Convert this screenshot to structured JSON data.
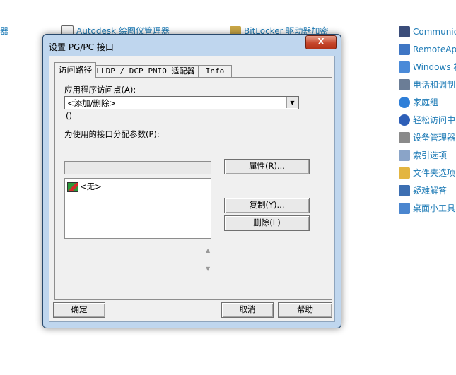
{
  "background": {
    "left_fragment": "器",
    "top_links": [
      {
        "label": "Autodesk 绘图仪管理器",
        "icon": "plotter-icon"
      },
      {
        "label": "BitLocker 驱动器加密",
        "icon": "bitlocker-icon"
      }
    ],
    "right_items": [
      {
        "label": "Communic",
        "icon": "comm-settings-icon",
        "color": "#3b4d7a"
      },
      {
        "label": "RemoteAp",
        "icon": "remoteapp-icon",
        "color": "#3f76c4"
      },
      {
        "label": "Windows 衫",
        "icon": "windows-icon",
        "color": "#4a8ad8"
      },
      {
        "label": "电话和调制",
        "icon": "phone-modem-icon",
        "color": "#6b7d96"
      },
      {
        "label": "家庭组",
        "icon": "homegroup-icon",
        "color": "#2f7fd8"
      },
      {
        "label": "轻松访问中",
        "icon": "ease-of-access-icon",
        "color": "#2e5fb8"
      },
      {
        "label": "设备管理器",
        "icon": "device-manager-icon",
        "color": "#8a8a8a"
      },
      {
        "label": "索引选项",
        "icon": "indexing-icon",
        "color": "#8aa4c8"
      },
      {
        "label": "文件夹选项",
        "icon": "folder-options-icon",
        "color": "#e3b541"
      },
      {
        "label": "疑难解答",
        "icon": "troubleshoot-icon",
        "color": "#3d6fb2"
      },
      {
        "label": "桌面小工具",
        "icon": "gadgets-icon",
        "color": "#4b86cf"
      }
    ]
  },
  "dialog": {
    "title": "设置 PG/PC 接口",
    "close_label": "X",
    "tabs": [
      "访问路径",
      "LLDP / DCP",
      "PNIO 适配器",
      "Info"
    ],
    "access_point_label": "应用程序访问点(A):",
    "access_point_value": "<添加/删除>",
    "parens_text": "()",
    "param_label": "为使用的接口分配参数(P):",
    "interface_item": "<无>",
    "properties_button": "属性(R)...",
    "copy_button": "复制(Y)...",
    "delete_button": "删除(L)",
    "scroll_up": "▲",
    "scroll_down": "▼",
    "ok_button": "确定",
    "cancel_button": "取消",
    "help_button": "帮助"
  }
}
